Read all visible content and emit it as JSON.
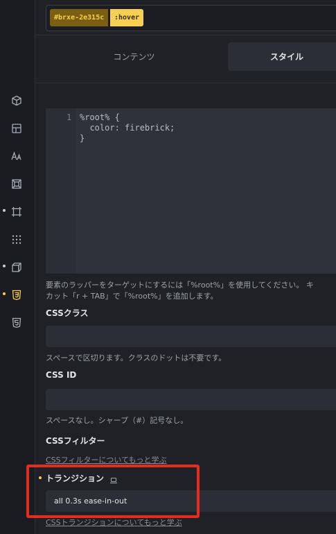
{
  "selector": {
    "id": "#brxe-2e315c",
    "state": ":hover"
  },
  "tabs": {
    "content": "コンテンツ",
    "style": "スタイル"
  },
  "editor": {
    "line_number": "1",
    "lines": [
      "%root% {",
      "  color: firebrick;",
      "}"
    ]
  },
  "custom_css_help": {
    "line1": "要素のラッパーをターゲットにするには「%root%」を使用してください。 キ",
    "line2": "カット「r + TAB」で「%root%」を追加します。"
  },
  "css_class": {
    "label": "CSSクラス",
    "value": "",
    "help": "スペースで区切ります。クラスのドットは不要です。"
  },
  "css_id": {
    "label": "CSS ID",
    "value": "",
    "help": "スペースなし。シャープ（#）記号なし。"
  },
  "css_filter": {
    "label": "CSSフィルター",
    "link": "CSSフィルターについてもっと学ぶ"
  },
  "transition": {
    "label": "トランジション",
    "value": "all 0.3s ease-in-out",
    "link": "CSSトランジションについてもっと学ぶ"
  },
  "colors": {
    "accent": "#f6cf54",
    "highlight": "#e42c1f"
  }
}
